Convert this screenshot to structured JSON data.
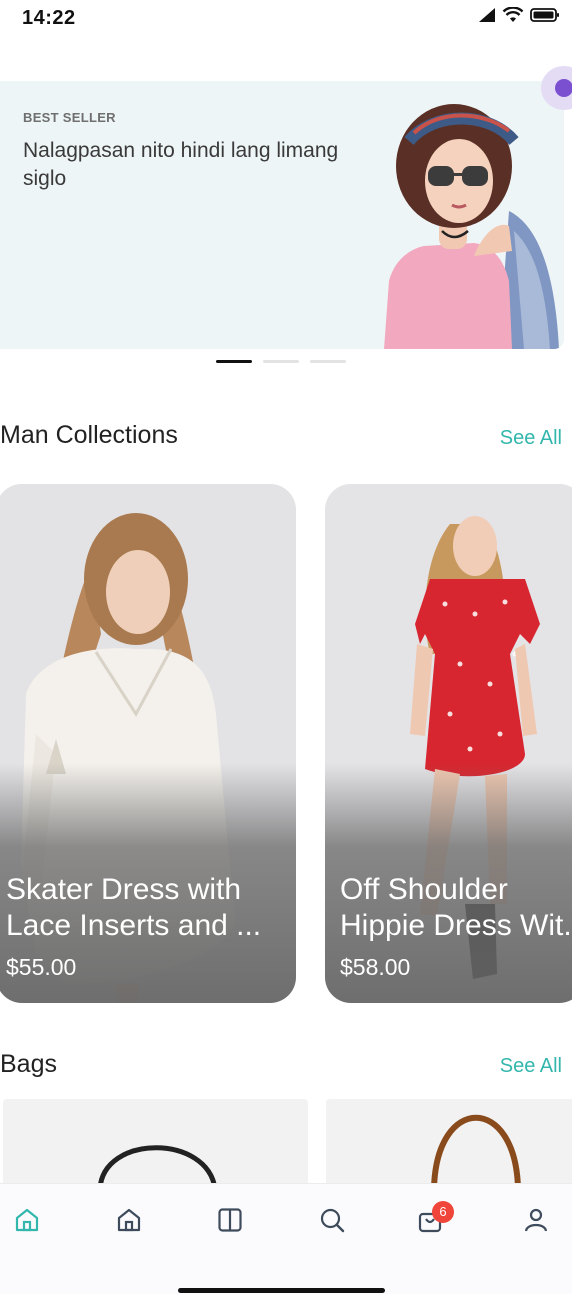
{
  "status_bar": {
    "time": "14:22"
  },
  "banner": {
    "tag": "BEST SELLER",
    "title": "Nalagpasan nito hindi lang limang siglo",
    "slides_total": 3,
    "active_slide": 1
  },
  "sections": {
    "man_collections": {
      "title": "Man Collections",
      "see_all": "See All",
      "items": [
        {
          "name": "Skater Dress with\nLace Inserts and ...",
          "price": "$55.00"
        },
        {
          "name": "Off Shoulder\nHippie Dress Wit...",
          "price": "$58.00"
        }
      ]
    },
    "bags": {
      "title": "Bags",
      "see_all": "See All"
    }
  },
  "bottom_nav": {
    "items": [
      {
        "icon": "home-icon",
        "active": true
      },
      {
        "icon": "store-icon",
        "active": false
      },
      {
        "icon": "layout-icon",
        "active": false
      },
      {
        "icon": "search-icon",
        "active": false
      },
      {
        "icon": "cart-icon",
        "active": false
      },
      {
        "icon": "profile-icon",
        "active": false
      }
    ],
    "cart_badge": "6"
  },
  "colors": {
    "accent": "#33b7ad",
    "banner_bg": "#eef5f7",
    "badge": "#f0453a",
    "fab": "#7a4fd0"
  }
}
